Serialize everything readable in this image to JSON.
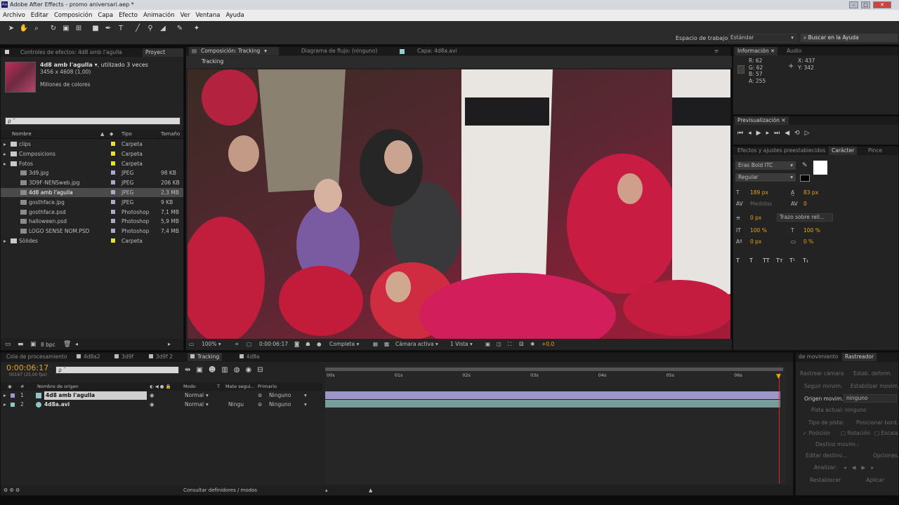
{
  "app": {
    "title": "Adobe After Effects - promo aniversari.aep *",
    "menu": [
      "Archivo",
      "Editar",
      "Composición",
      "Capa",
      "Efecto",
      "Animación",
      "Ver",
      "Ventana",
      "Ayuda"
    ],
    "workspace_label": "Espacio de trabajo:",
    "workspace_value": "Estándar",
    "help_placeholder": "Buscar en la Ayuda"
  },
  "project": {
    "tab_effects": "Controles de efectos: 4d8 amb l'agulla",
    "tab_project": "Proyect",
    "item_name": "4d8 amb l'agulla ▾",
    "item_used": ", utilizado 3 veces",
    "item_size": "3456 x 4608 (1,00)",
    "item_colors": "Millones de colores",
    "search_placeholder": "ρ ˜",
    "col_name": "Nombre",
    "col_type": "Tipo",
    "col_size": "Tamaño",
    "items": [
      {
        "name": "clips",
        "type": "Carpeta",
        "size": "",
        "folder": true,
        "indent": 0,
        "label": "#e6e22e"
      },
      {
        "name": "Composicions",
        "type": "Carpeta",
        "size": "",
        "folder": true,
        "indent": 0,
        "label": "#e6e22e"
      },
      {
        "name": "Fotos",
        "type": "Carpeta",
        "size": "",
        "folder": true,
        "indent": 0,
        "label": "#e6e22e"
      },
      {
        "name": "3d9.jpg",
        "type": "JPEG",
        "size": "98 KB",
        "folder": false,
        "indent": 1,
        "label": "#a9a9c9"
      },
      {
        "name": "3D9F-NENSweb.jpg",
        "type": "JPEG",
        "size": "206 KB",
        "folder": false,
        "indent": 1,
        "label": "#a9a9c9"
      },
      {
        "name": "4d8 amb l'agulla",
        "type": "JPEG",
        "size": "2,3 MB",
        "folder": false,
        "indent": 1,
        "label": "#a9a9c9",
        "selected": true
      },
      {
        "name": "gosthface.jpg",
        "type": "JPEG",
        "size": "9 KB",
        "folder": false,
        "indent": 1,
        "label": "#a9a9c9"
      },
      {
        "name": "gosthface.psd",
        "type": "Photoshop",
        "size": "7,1 MB",
        "folder": false,
        "indent": 1,
        "label": "#a9a9c9"
      },
      {
        "name": "halloween.psd",
        "type": "Photoshop",
        "size": "5,9 MB",
        "folder": false,
        "indent": 1,
        "label": "#a9a9c9"
      },
      {
        "name": "LOGO SENSE NOM.PSD",
        "type": "Photoshop",
        "size": "7,4 MB",
        "folder": false,
        "indent": 1,
        "label": "#a9a9c9"
      },
      {
        "name": "Sòlides",
        "type": "Carpeta",
        "size": "",
        "folder": true,
        "indent": 0,
        "label": "#e6e22e"
      }
    ],
    "bpc": "8 bpc"
  },
  "composition": {
    "tab_comp": "Composición: Tracking",
    "tab_flow": "Diagrama de flujo: (ninguno)",
    "tab_layer": "Capa: 4d8a.avi",
    "subtab": "Tracking",
    "zoom": "100%",
    "timecode": "0:00:06:17",
    "resolution": "Completa",
    "camera": "Cámara activa",
    "views": "1 Vista",
    "exposure": "+0,0"
  },
  "info": {
    "tab_info": "Información",
    "tab_audio": "Audio",
    "r": "R:  62",
    "g": "G:  62",
    "b": "B:  57",
    "a": "A:  255",
    "x": "X:  437",
    "y": "Y:  342"
  },
  "preview": {
    "tab": "Previsualización"
  },
  "character": {
    "tab_effects": "Efectos y ajustes preestablecidos",
    "tab_char": "Carácter",
    "tab_brush": "Pince",
    "font": "Eras Bold ITC",
    "style": "Regular",
    "size": "189 px",
    "leading": "83 px",
    "kerning": "Medidas",
    "tracking": "0",
    "stroke": "0 px",
    "stroke_mode": "Trazo sobre rell...",
    "vscale": "100 %",
    "hscale": "100 %",
    "baseline": "0 px",
    "tsume": "0 %",
    "styles": [
      "T",
      "T",
      "TT",
      "Tт",
      "T¹",
      "T₁"
    ]
  },
  "timeline": {
    "tabs": [
      "Cola de procesamiento",
      "4d8a2",
      "3d9f",
      "3d9f 2",
      "Tracking",
      "4d8a"
    ],
    "timecode": "0:00:06:17",
    "frame_info": "00167 (25,00 fps)",
    "search_placeholder": "ρ ˜",
    "col_hash": "#",
    "col_source": "Nombre de origen",
    "col_mode": "Modo",
    "col_t": "T",
    "col_matte": "Mate segui...",
    "col_parent": "Primario",
    "layers": [
      {
        "num": "1",
        "name": "4d8 amb l'agulla",
        "mode": "Normal",
        "matte": "",
        "parent": "Ninguno",
        "color": "#9a9ad2",
        "selected": true
      },
      {
        "num": "2",
        "name": "4d8a.avi",
        "mode": "Normal",
        "matte": "Ningu",
        "parent": "Ninguno",
        "color": "#8fc7c7",
        "selected": false
      }
    ],
    "ruler": [
      "00s",
      "01s",
      "02s",
      "03s",
      "04s",
      "05s",
      "06s"
    ],
    "footer": "Consultar definidores / modos"
  },
  "tracker": {
    "tab_motion": "de movimiento",
    "tab_tracker": "Rastreador",
    "track_camera": "Rastrear cámara",
    "stabilize_warp": "Estab. deform.",
    "track_motion": "Seguir movim.",
    "stabilize_motion": "Estabilizar movim.",
    "motion_source_label": "Origen movim.:",
    "motion_source": "ninguno",
    "current_track_label": "Pista actual:",
    "current_track": "ninguno",
    "track_type_label": "Tipo de pista:",
    "track_type": "Posicionar bord...",
    "position": "Posición",
    "rotation": "Rotación",
    "scale": "Escala",
    "motion_target": "Destino movim.:",
    "edit_target": "Editar destino...",
    "options": "Opciones...",
    "analyze": "Analizar:",
    "reset": "Restablecer",
    "apply": "Aplicar"
  }
}
